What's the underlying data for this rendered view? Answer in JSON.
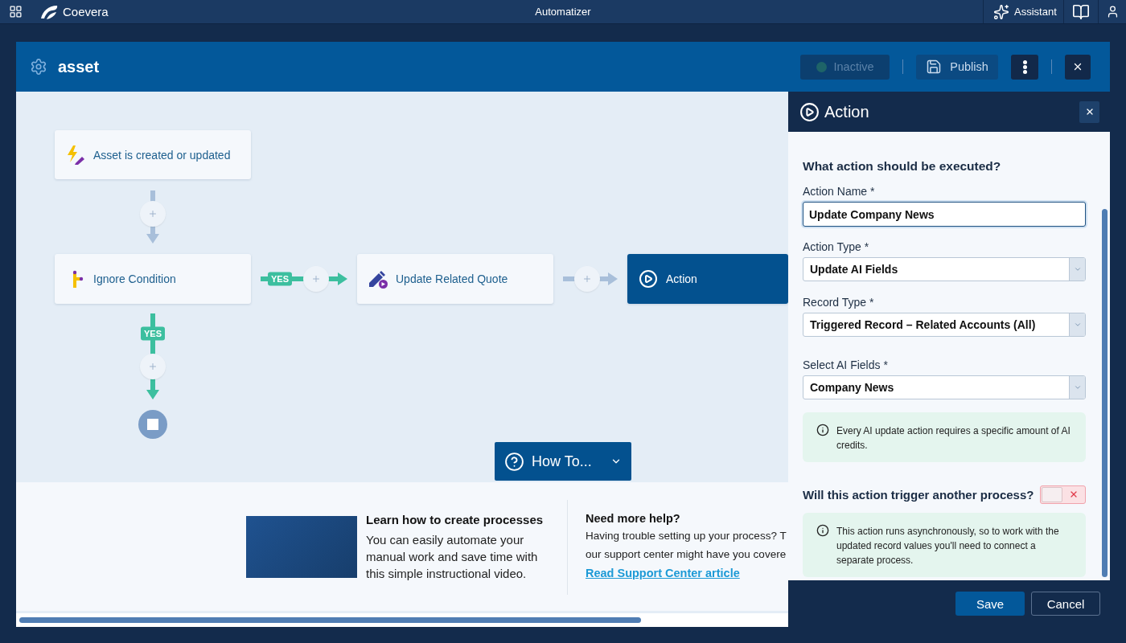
{
  "top_bar": {
    "brand": "Coevera",
    "title": "Automatizer",
    "assistant": "Assistant"
  },
  "process": {
    "name": "asset",
    "status": {
      "label": "Inactive",
      "active": false
    },
    "publish": "Publish"
  },
  "flow": {
    "nodes": [
      {
        "kind": "trigger",
        "label": "Asset is created or updated",
        "selected": false
      },
      {
        "kind": "condition",
        "label": "Ignore Condition",
        "selected": false
      },
      {
        "kind": "update",
        "label": "Update Related Quote",
        "selected": false
      },
      {
        "kind": "action",
        "label": "Action",
        "selected": true
      }
    ],
    "edges": [
      {
        "kind": "plain"
      },
      {
        "kind": "yes",
        "label": "YES"
      },
      {
        "kind": "plain"
      },
      {
        "kind": "yes",
        "label": "YES"
      }
    ],
    "how_to": "How To..."
  },
  "help": {
    "video": {
      "title": "Learn how to create processes",
      "text": "You can easily automate your manual work and save time with this simple instructional video."
    },
    "support": {
      "title": "Need more help?",
      "lines": [
        "Having trouble setting up your process? T",
        "our support center might have you covere"
      ],
      "link": "Read Support Center article"
    }
  },
  "panel": {
    "title": "Action",
    "heading": "What action should be executed?",
    "fields": [
      {
        "kind": "input",
        "label": "Action Name *",
        "value": "Update Company News",
        "focused": true
      },
      {
        "kind": "select",
        "label": "Action Type *",
        "value": "Update AI Fields",
        "focused": false
      },
      {
        "kind": "select",
        "label": "Record Type *",
        "value": "Triggered Record – Related Accounts (All)",
        "focused": false
      },
      {
        "kind": "select",
        "label": "Select AI Fields *",
        "value": "Company News",
        "focused": false
      }
    ],
    "notes": [
      "Every AI update action requires a specific amount of AI credits.",
      "This action runs asynchronously, so to work with the updated record values you'll need to connect a separate process."
    ],
    "question": "Will this action trigger another process?",
    "toggle": {
      "on": false
    },
    "buttons": [
      {
        "kind": "primary",
        "label": "Save"
      },
      {
        "kind": "secondary",
        "label": "Cancel"
      }
    ]
  }
}
